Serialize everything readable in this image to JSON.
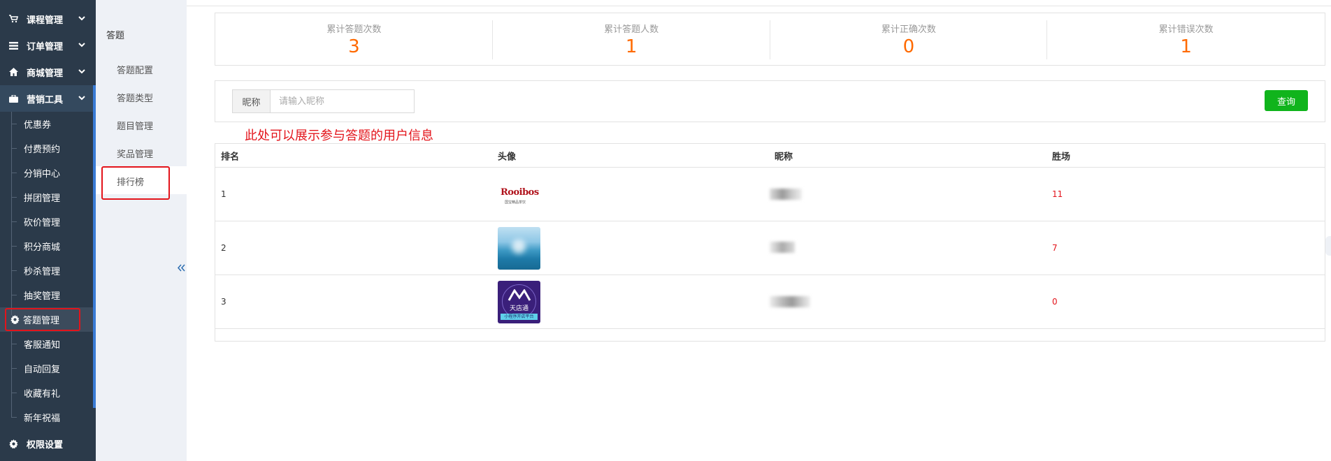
{
  "sidebar": {
    "groups": [
      {
        "label": "课程管理",
        "icon": "cart-icon"
      },
      {
        "label": "订单管理",
        "icon": "list-icon"
      },
      {
        "label": "商城管理",
        "icon": "home-icon"
      },
      {
        "label": "营销工具",
        "icon": "briefcase-icon"
      }
    ],
    "marketing_items": [
      "优惠券",
      "付费预约",
      "分销中心",
      "拼团管理",
      "砍价管理",
      "积分商城",
      "秒杀管理",
      "抽奖管理",
      "答题管理",
      "客服通知",
      "自动回复",
      "收藏有礼",
      "新年祝福"
    ],
    "active_item": "答题管理",
    "bottom_group": {
      "label": "权限设置",
      "icon": "gear-icon"
    }
  },
  "submenu": {
    "title": "答题",
    "items": [
      "答题配置",
      "答题类型",
      "题目管理",
      "奖品管理",
      "排行榜"
    ],
    "active": "排行榜"
  },
  "stats": [
    {
      "label": "累计答题次数",
      "value": "3"
    },
    {
      "label": "累计答题人数",
      "value": "1"
    },
    {
      "label": "累计正确次数",
      "value": "0"
    },
    {
      "label": "累计错误次数",
      "value": "1"
    }
  ],
  "search": {
    "label": "昵称",
    "placeholder": "请输入昵称",
    "value": "",
    "button": "查询"
  },
  "annotation": "此处可以展示参与答题的用户信息",
  "table": {
    "headers": [
      "排名",
      "头像",
      "昵称",
      "胜场"
    ],
    "rows": [
      {
        "rank": "1",
        "avatar": "Rooibos",
        "avatar_sub": "国宝精品茶饮",
        "wins": "11"
      },
      {
        "rank": "2",
        "avatar": "sea-image",
        "wins": "7"
      },
      {
        "rank": "3",
        "avatar": "天店通",
        "avatar_sub": "小程序开店平台",
        "wins": "0"
      }
    ]
  },
  "colors": {
    "sidebar_bg": "#2b3a4a",
    "accent": "#ff6a00",
    "query_button": "#10b41c",
    "highlight": "#e3141b"
  }
}
